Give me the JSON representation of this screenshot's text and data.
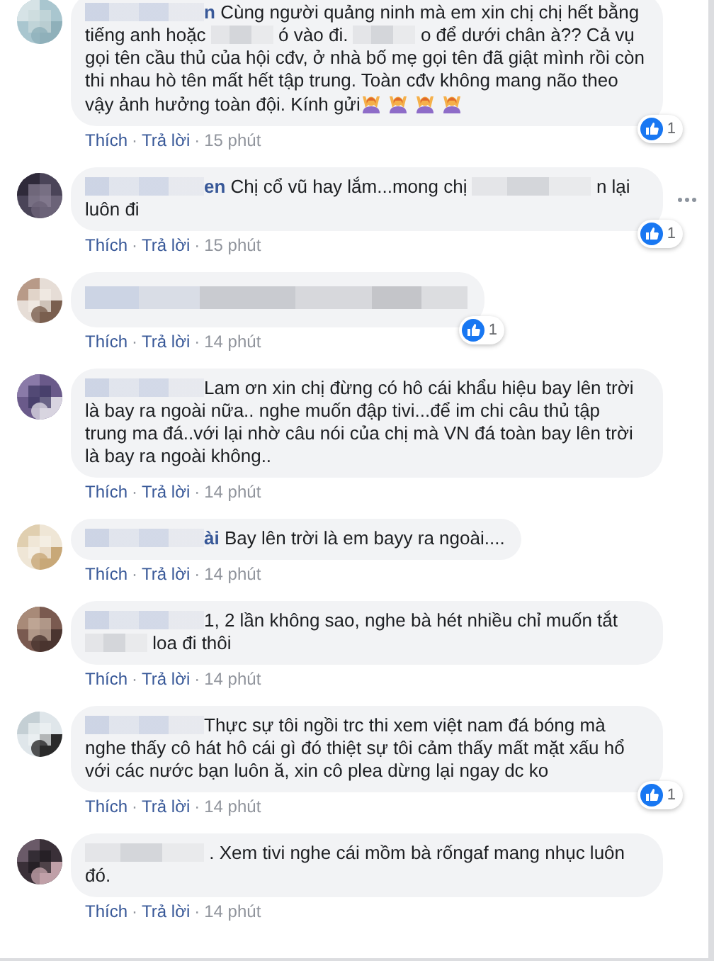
{
  "comments": [
    {
      "avatar": {
        "kind": "picture"
      },
      "segments": [
        {
          "kind": "name_blur"
        },
        {
          "kind": "name",
          "text": "n"
        },
        {
          "kind": "text",
          "text": "Cùng người quảng ninh mà em xin chị chị hết bằng tiếng anh hoặc"
        },
        {
          "kind": "blur"
        },
        {
          "kind": "text",
          "text": "ó vào đi."
        },
        {
          "kind": "blur"
        },
        {
          "kind": "text",
          "text": "o để dưới chân à?? Cả vụ gọi tên cầu thủ của hội cđv, ở nhà bố mẹ gọi tên đã giật mình rồi còn thi nhau hò tên mất hết tập trung. Toàn cđv không mang não theo vậy ảnh hưởng toàn đội. Kính gửi"
        },
        {
          "kind": "emoji"
        },
        {
          "kind": "emoji"
        },
        {
          "kind": "emoji"
        },
        {
          "kind": "emoji"
        }
      ],
      "likes": "1",
      "options": false,
      "actions": [
        "Thích",
        "Trả lời"
      ],
      "separator": "·",
      "time": "15 phút"
    },
    {
      "avatar": {
        "kind": "picture"
      },
      "segments": [
        {
          "kind": "name_blur"
        },
        {
          "kind": "name",
          "text": "en"
        },
        {
          "kind": "text",
          "text": "Chị cổ vũ hay lắm...mong chị"
        },
        {
          "kind": "blur_long"
        },
        {
          "kind": "text",
          "text": "n lại luôn đi"
        }
      ],
      "likes": "1",
      "options": true,
      "actions": [
        "Thích",
        "Trả lời"
      ],
      "separator": "·",
      "time": "15 phút"
    },
    {
      "avatar": {
        "kind": "picture"
      },
      "segments": [
        {
          "kind": "blur_line"
        }
      ],
      "likes": "1",
      "options": false,
      "actions": [
        "Thích",
        "Trả lời"
      ],
      "separator": "·",
      "time": "14 phút"
    },
    {
      "avatar": {
        "kind": "picture"
      },
      "segments": [
        {
          "kind": "name_blur"
        },
        {
          "kind": "text",
          "text": "Lam ơn xin chị đừng có hô cái khẩu hiệu bay lên trời là bay ra ngoài nữa.. nghe muốn đập tivi...để im chi câu thủ tập trung ma đá..với lại nhờ câu nói của chị mà VN đá toàn bay lên trời là bay ra ngoài không.."
        }
      ],
      "options": false,
      "actions": [
        "Thích",
        "Trả lời"
      ],
      "separator": "·",
      "time": "14 phút"
    },
    {
      "avatar": {
        "kind": "picture"
      },
      "segments": [
        {
          "kind": "name_blur"
        },
        {
          "kind": "name",
          "text": "ài"
        },
        {
          "kind": "text",
          "text": "Bay lên trời là em bayy ra ngoài...."
        }
      ],
      "options": false,
      "actions": [
        "Thích",
        "Trả lời"
      ],
      "separator": "·",
      "time": "14 phút"
    },
    {
      "avatar": {
        "kind": "picture"
      },
      "segments": [
        {
          "kind": "name_blur"
        },
        {
          "kind": "text",
          "text": "1, 2 lần không sao, nghe bà hét nhiều chỉ muốn tắt"
        },
        {
          "kind": "blur"
        },
        {
          "kind": "text",
          "text": "loa đi thôi"
        }
      ],
      "options": false,
      "actions": [
        "Thích",
        "Trả lời"
      ],
      "separator": "·",
      "time": "14 phút"
    },
    {
      "avatar": {
        "kind": "picture"
      },
      "segments": [
        {
          "kind": "name_blur"
        },
        {
          "kind": "text",
          "text": "Thực sự tôi ngồi trc thi xem việt nam đá bóng mà nghe thấy cô hát hô cái gì đó thiệt sự tôi cảm thấy mất mặt xấu hổ với các nước bạn luôn ă, xin cô plea dừng lại ngay dc ko"
        }
      ],
      "likes": "1",
      "options": false,
      "actions": [
        "Thích",
        "Trả lời"
      ],
      "separator": "·",
      "time": "14 phút"
    },
    {
      "avatar": {
        "kind": "picture"
      },
      "segments": [
        {
          "kind": "blur_long"
        },
        {
          "kind": "text",
          "text": ". Xem tivi nghe cái mồm bà rốngaf mang nhục luôn đó."
        }
      ],
      "options": false,
      "actions": [
        "Thích",
        "Trả lời"
      ],
      "separator": "·",
      "time": "14 phút"
    }
  ]
}
